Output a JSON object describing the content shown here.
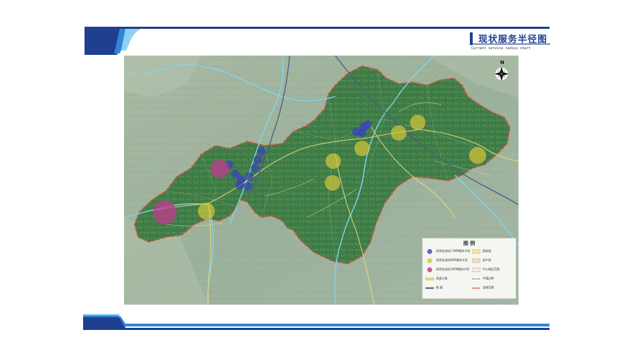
{
  "header": {
    "title": "现状服务半径图",
    "subtitle": "Current service radius chart"
  },
  "map": {
    "north_label": "N",
    "colors": {
      "terrain_base": "#9fb49a",
      "county_fill": "#3d7a45",
      "county_border": "#d2533c",
      "river": "#7fd6ee",
      "road_yellow": "#e9dc7d",
      "railway": "#4a5a86",
      "marker_blue": "#3a3fc4",
      "marker_magenta": "#c23a92",
      "marker_yellow": "#d6c63a"
    }
  },
  "legend": {
    "title": "图 例",
    "left_items": [
      {
        "label": "现状加油站1.5KM服务半径",
        "symbol": "blue-circle"
      },
      {
        "label": "现状加油站6KM服务半径",
        "symbol": "yellow-circle"
      },
      {
        "label": "现状加油站10KM服务半径",
        "symbol": "magenta-circle"
      },
      {
        "label": "高速公路",
        "symbol": "highway-line"
      },
      {
        "label": "铁 路",
        "symbol": "railway-line"
      }
    ],
    "right_items": [
      {
        "label": "国省道",
        "symbol": "national-road-line"
      },
      {
        "label": "县乡道",
        "symbol": "county-road-line"
      },
      {
        "label": "中心城区范围",
        "symbol": "urban-area"
      },
      {
        "label": "乡镇边界",
        "symbol": "township-boundary"
      },
      {
        "label": "县域范围",
        "symbol": "county-boundary"
      }
    ]
  }
}
